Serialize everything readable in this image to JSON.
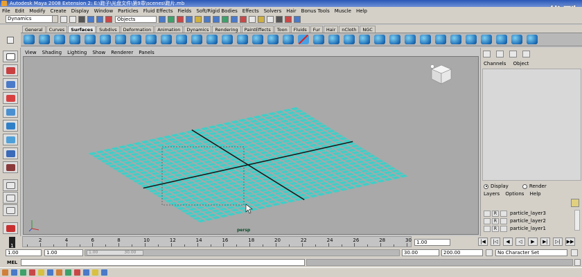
{
  "window": {
    "title": "Autodesk Maya 2008 Extension 2: E:\\鞋子\\光盘文件\\第9章\\scenes\\鞋片.mb",
    "watermark": "优酷"
  },
  "menubar": [
    "File",
    "Edit",
    "Modify",
    "Create",
    "Display",
    "Window",
    "Particles",
    "Fluid Effects",
    "Fields",
    "Soft/Rigid Bodies",
    "Effects",
    "Solvers",
    "Hair",
    "Bonus Tools",
    "Muscle",
    "Help"
  ],
  "statusline": {
    "mode": "Dynamics",
    "objects_field": "Objects",
    "icons": [
      "new-scene-icon",
      "open-scene-icon",
      "save-scene-icon",
      "select-hierarchy-icon",
      "select-object-icon",
      "select-component-icon",
      "snap-grid-icon",
      "snap-curve-icon",
      "snap-point-icon",
      "history-icon",
      "render-icon",
      "ipr-render-icon",
      "render-settings-icon",
      "hypershade-icon"
    ]
  },
  "shelf_tabs": [
    "General",
    "Curves",
    "Surfaces",
    "Subdivs",
    "Deformation",
    "Animation",
    "Dynamics",
    "Rendering",
    "PaintEffects",
    "Toon",
    "Fluids",
    "Fur",
    "Hair",
    "nCloth",
    "NGC"
  ],
  "shelf_active": "Surfaces",
  "viewport": {
    "menu": [
      "View",
      "Shading",
      "Lighting",
      "Show",
      "Renderer",
      "Panels"
    ],
    "camera_label": "persp",
    "grid_color": "#3ecfc8"
  },
  "right_panel": {
    "menu": [
      "Channels",
      "Object"
    ],
    "display_tab": "Display",
    "render_tab": "Render",
    "layers_menu": [
      "Layers",
      "Options",
      "Help"
    ],
    "layers": [
      {
        "r": "R",
        "name": "particle_layer3"
      },
      {
        "r": "R",
        "name": "particle_layer2"
      },
      {
        "r": "R",
        "name": "particle_layer1"
      }
    ]
  },
  "timeslider": {
    "ticks": [
      "2",
      "4",
      "6",
      "8",
      "10",
      "12",
      "14",
      "16",
      "18",
      "20",
      "22",
      "24",
      "26",
      "28",
      "30"
    ],
    "current_label": "1",
    "current_frame": "1.00"
  },
  "rangeslider": {
    "start": "1.00",
    "playback_start": "1.00",
    "handle_start": "1.00",
    "handle_end": "30.00",
    "playback_end": "30.00",
    "end": "200.00",
    "character_set": "No Character Set"
  },
  "cmdline": {
    "label": "MEL"
  }
}
